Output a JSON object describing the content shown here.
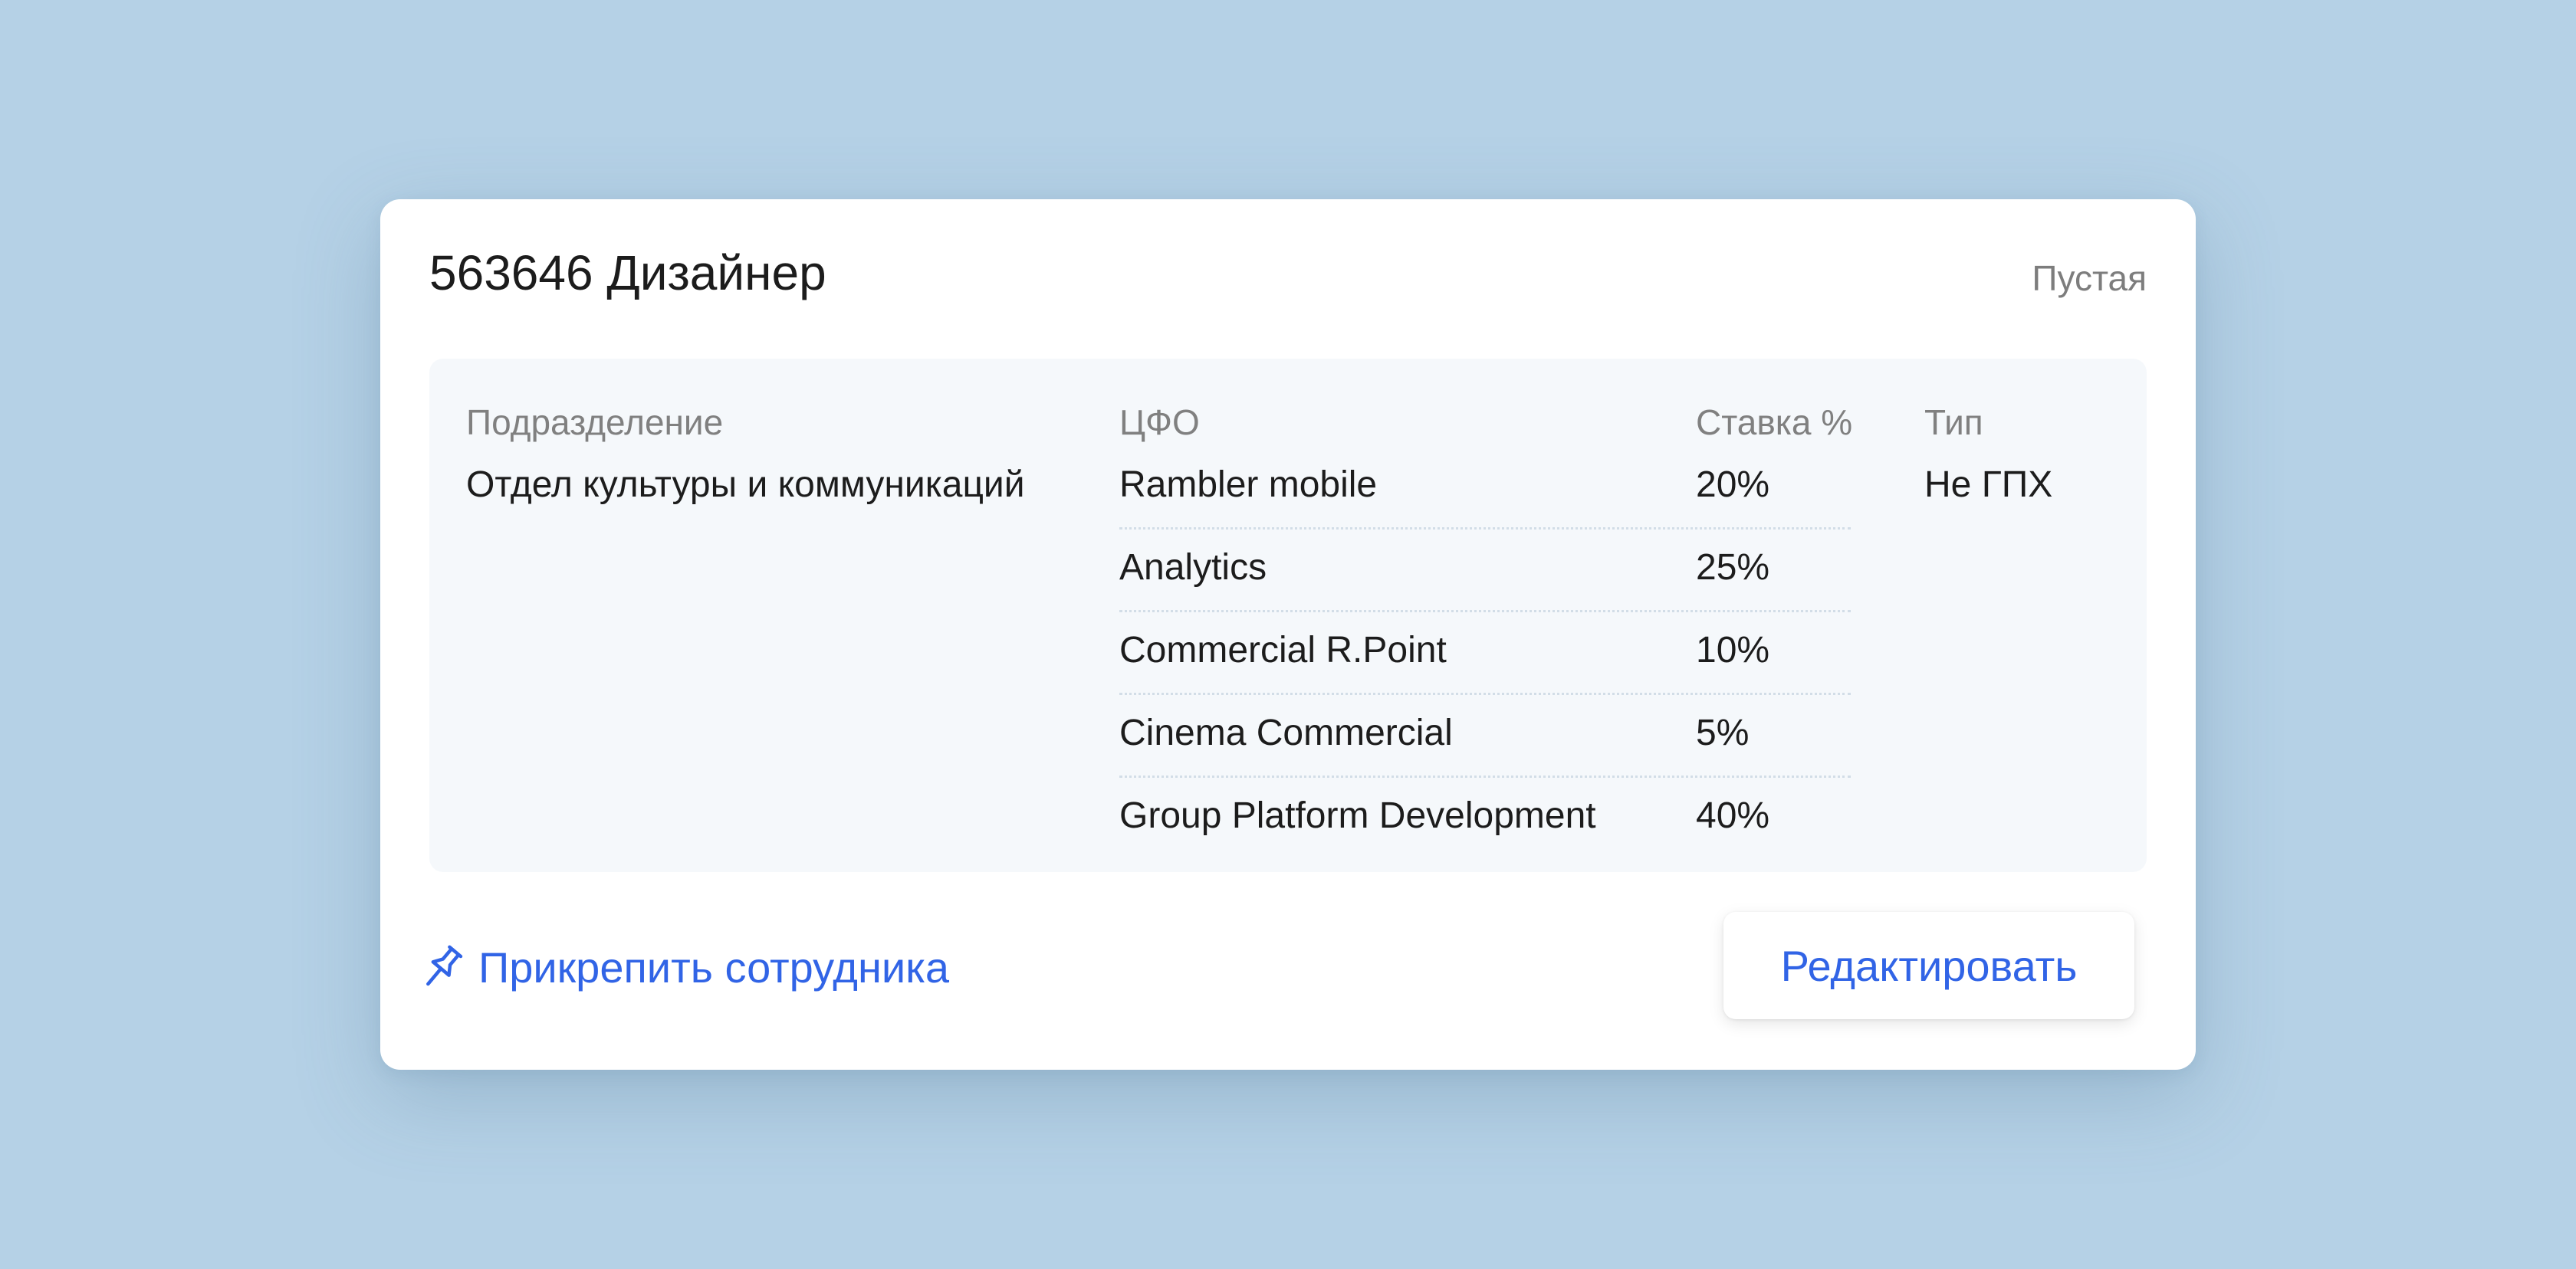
{
  "card": {
    "title": "563646 Дизайнер",
    "status": "Пустая"
  },
  "table": {
    "headers": {
      "department": "Подразделение",
      "cfo": "ЦФО",
      "rate": "Ставка %",
      "type": "Тип"
    },
    "department": "Отдел культуры и коммуникаций",
    "type": "Не ГПХ",
    "allocations": [
      {
        "cfo": "Rambler mobile",
        "rate": "20%"
      },
      {
        "cfo": "Analytics",
        "rate": "25%"
      },
      {
        "cfo": "Commercial R.Point",
        "rate": "10%"
      },
      {
        "cfo": "Cinema Commercial",
        "rate": "5%"
      },
      {
        "cfo": "Group Platform Development",
        "rate": "40%"
      }
    ]
  },
  "actions": {
    "attach_label": "Прикрепить сотрудника",
    "attach_icon": "pin-icon",
    "edit_label": "Редактировать"
  },
  "colors": {
    "background": "#b5d1e6",
    "accent": "#3164e6",
    "panel": "#f5f8fb"
  }
}
